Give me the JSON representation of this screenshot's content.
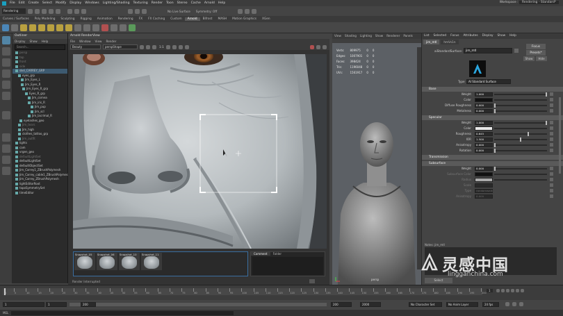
{
  "menubar": [
    "File",
    "Edit",
    "Create",
    "Select",
    "Modify",
    "Display",
    "Windows",
    "Lighting/Shading",
    "Texturing",
    "Render",
    "Toon",
    "Stereo",
    "Cache",
    "Arnold",
    "Help"
  ],
  "workspace": {
    "label": "Workspace :",
    "value": "Rendering - Standard*"
  },
  "statusline": {
    "mode": "Rendering",
    "live_surface": "No Live Surface",
    "symmetry": "Symmetry: Off"
  },
  "shelf_tabs": [
    "Curves / Surfaces",
    "Poly Modeling",
    "Sculpting",
    "Rigging",
    "Animation",
    "Rendering",
    "FX",
    "FX Caching",
    "Custom",
    "Arnold",
    "Bifrost",
    "MASH",
    "Motion Graphics",
    "XGen"
  ],
  "shelf_active": "Arnold",
  "outliner": {
    "title": "Outliner",
    "menu": [
      "Display",
      "Show",
      "Help"
    ],
    "search_placeholder": "Search...",
    "items": [
      {
        "label": "persp",
        "dim": true
      },
      {
        "label": "top",
        "dim": true
      },
      {
        "label": "front",
        "dim": true
      },
      {
        "label": "side",
        "dim": true
      },
      {
        "label": "skel_CARREY_GRP"
      },
      {
        "label": "eyes_grp"
      },
      {
        "label": "Jim_Eyes_L"
      },
      {
        "label": "Jim_Eyes_R"
      },
      {
        "label": "Jim_Eyes_R_grp"
      },
      {
        "label": "Eyes_R_grp"
      },
      {
        "label": "Jim_cornea"
      },
      {
        "label": "Jim_iris_R"
      },
      {
        "label": "Jim_pup"
      },
      {
        "label": "Jim_scl"
      },
      {
        "label": "Jim_lacrimal_R"
      },
      {
        "label": "eyelashes_geo"
      },
      {
        "label": "Jim_tears",
        "dim": true
      },
      {
        "label": "Jim_high"
      },
      {
        "label": "clothes_tattoo_grp"
      },
      {
        "label": "Jim_outfit",
        "dim": true
      },
      {
        "label": "lights"
      },
      {
        "label": "cam"
      },
      {
        "label": "vrgen_geo"
      },
      {
        "label": "defaultLightSet",
        "dim": true
      },
      {
        "label": "defaultLightSet"
      },
      {
        "label": "defaultObjectSet"
      },
      {
        "label": "Jim_Carrey1_ZBrushPolymesh"
      },
      {
        "label": "Jim_Carrey_cable1_ZBrushPolymesh"
      },
      {
        "label": "Jim_Carrey_ZBrushPolymesh"
      },
      {
        "label": "lightEditorRoot"
      },
      {
        "label": "topoSymmetrySet"
      },
      {
        "label": "timeEditor"
      }
    ]
  },
  "renderview": {
    "title": "Arnold RenderView",
    "menu": [
      "File",
      "Window",
      "View",
      "Render"
    ],
    "aov": "Beauty",
    "camera": "perspShape",
    "zoom": "1:1",
    "snapshots": [
      "Snapshot_05",
      "Snapshot_06",
      "Snapshot_10",
      "Snapshot_11"
    ],
    "comment_tabs": [
      "Comment",
      "Folder"
    ],
    "status": "Render Interrupted"
  },
  "viewport": {
    "menu": [
      "View",
      "Shading",
      "Lighting",
      "Show",
      "Renderer",
      "Panels"
    ],
    "hud": [
      {
        "label": "Verts:",
        "v1": "809975",
        "v2": "0",
        "v3": "0"
      },
      {
        "label": "Edges:",
        "v1": "1007901",
        "v2": "0",
        "v3": "0"
      },
      {
        "label": "Faces:",
        "v1": "398424",
        "v2": "0",
        "v3": "0"
      },
      {
        "label": "Tris:",
        "v1": "1196048",
        "v2": "0",
        "v3": "0"
      },
      {
        "label": "UVs:",
        "v1": "1561917",
        "v2": "0",
        "v3": "0"
      }
    ],
    "camera_label": "persp"
  },
  "attr_editor": {
    "menu": [
      "List",
      "Selected",
      "Focus",
      "Attributes",
      "Display",
      "Show",
      "Help"
    ],
    "tabs": [
      "jim_mtl",
      "hmVs1n"
    ],
    "node_type": "aiStandardSurface:",
    "node_name": "jim_mtl",
    "focus_btn": "Focus",
    "presets_btn": "Presets*",
    "show_btn": "Show",
    "hide_btn": "Hide",
    "type_label": "Type",
    "type_value": "AI Standard Surface",
    "sections": [
      {
        "title": "Base",
        "rows": [
          {
            "label": "Weight",
            "value": "1.000",
            "knob": 1.0
          },
          {
            "label": "Color",
            "swatch": "#111111"
          },
          {
            "label": "Diffuse Roughness",
            "value": "0.000",
            "knob": 0.0
          },
          {
            "label": "Metalness",
            "value": "0.000",
            "knob": 0.0
          }
        ]
      },
      {
        "title": "Specular",
        "rows": [
          {
            "label": "Weight",
            "value": "1.000",
            "knob": 1.0
          },
          {
            "label": "Color",
            "swatch": "#e8e8e8"
          },
          {
            "label": "Roughness",
            "value": "0.645",
            "knob": 0.645
          },
          {
            "label": "IOR",
            "value": "1.500",
            "knob": 0.5
          },
          {
            "label": "Anisotropy",
            "value": "0.000",
            "knob": 0.0
          },
          {
            "label": "Rotation",
            "value": "0.000",
            "knob": 0.0
          }
        ]
      },
      {
        "title": "Transmission",
        "rows": []
      },
      {
        "title": "Subsurface",
        "rows": [
          {
            "label": "Weight",
            "value": "0.000",
            "knob": 0.0
          },
          {
            "label": "Subsurface Color",
            "swatch": "#111111",
            "dim": true
          },
          {
            "label": "Radius",
            "swatch": "#aaaaaa",
            "dim": true
          },
          {
            "label": "Scale",
            "value": "",
            "dim": true
          },
          {
            "label": "Type",
            "value": "randomwalk",
            "dim": true
          },
          {
            "label": "Anisotropy",
            "value": "0.000",
            "dim": true
          }
        ]
      }
    ],
    "notes": "Notes: jim_mtl",
    "footer_btn": "Select"
  },
  "timeline": {
    "ticks": [
      1,
      5,
      10,
      15,
      20,
      25,
      30,
      35,
      40,
      45,
      50,
      55,
      60,
      65,
      70,
      75,
      80,
      85,
      90,
      95,
      100,
      105,
      110,
      115,
      120,
      125,
      130,
      135,
      140,
      145,
      150,
      155,
      160,
      165,
      170,
      175,
      180,
      185,
      190,
      195,
      200
    ],
    "current": "1"
  },
  "range": {
    "start": "1",
    "inner_start": "1",
    "inner_end": "200",
    "end_a": "200",
    "end_b": "2000",
    "char_set": "No Character Set",
    "anim_layer": "No Anim Layer",
    "fps": "24 fps"
  },
  "cmdline": {
    "lang": "MEL"
  },
  "watermark": {
    "cn": "灵感中国",
    "url": "lingganchina.com"
  },
  "colors": {
    "accent": "#5285a6",
    "selection_frame": "#ffffff"
  }
}
